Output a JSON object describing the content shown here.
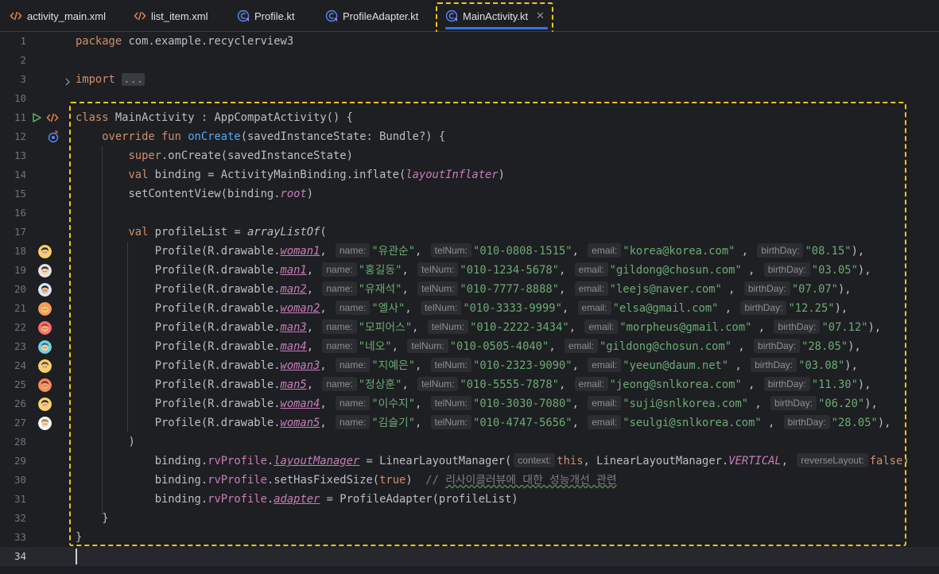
{
  "tabs": [
    {
      "label": "activity_main.xml",
      "icon": "xml-file-icon"
    },
    {
      "label": "list_item.xml",
      "icon": "xml-file-icon"
    },
    {
      "label": "Profile.kt",
      "icon": "kotlin-class-icon"
    },
    {
      "label": "ProfileAdapter.kt",
      "icon": "kotlin-class-icon"
    },
    {
      "label": "MainActivity.kt",
      "icon": "kotlin-class-icon",
      "active": true
    }
  ],
  "editor": {
    "line_numbers": [
      "1",
      "2",
      "3",
      "10",
      "11",
      "12",
      "13",
      "14",
      "15",
      "16",
      "17",
      "18",
      "19",
      "20",
      "21",
      "22",
      "23",
      "24",
      "25",
      "26",
      "27",
      "28",
      "29",
      "30",
      "31",
      "32",
      "33",
      "34"
    ],
    "package_kw": "package",
    "package_name": " com.example.recyclerview3",
    "import_kw": "import",
    "import_dots": "...",
    "class_kw": "class",
    "class_decl": " MainActivity : AppCompatActivity() {",
    "override_kw": "override",
    "fun_kw": " fun ",
    "fn_oncreate": "onCreate",
    "oncreate_params": "(savedInstanceState: Bundle?) {",
    "super_kw": "super",
    "super_call": ".onCreate(savedInstanceState)",
    "val_kw": "val",
    "binding_decl": " binding = ActivityMainBinding.inflate(",
    "layout_inflater": "layoutInflater",
    "close_paren": ")",
    "set_content_view": "setContentView(binding.",
    "root": "root",
    "profile_list_decl": " profileList = ",
    "array_list_of": "arrayListOf",
    "open_paren": "(",
    "profile_prefix": "Profile(R.drawable.",
    "hint_name": "name:",
    "hint_tel": "telNum:",
    "hint_email": "email:",
    "hint_birth": "birthDay:",
    "profiles": [
      {
        "drawable": "woman1",
        "name": "\"유관순\"",
        "tel": "\"010-0808-1515\"",
        "email": "\"korea@korea.com\"",
        "birth": "\"08.15\""
      },
      {
        "drawable": "man1",
        "name": "\"홍길동\"",
        "tel": "\"010-1234-5678\"",
        "email": "\"gildong@chosun.com\"",
        "birth": "\"03.05\""
      },
      {
        "drawable": "man2",
        "name": "\"유재석\"",
        "tel": "\"010-7777-8888\"",
        "email": "\"leejs@naver.com\"",
        "birth": "\"07.07\""
      },
      {
        "drawable": "woman2",
        "name": "\"엘사\"",
        "tel": "\"010-3333-9999\"",
        "email": "\"elsa@gmail.com\"",
        "birth": "\"12.25\""
      },
      {
        "drawable": "man3",
        "name": "\"모피어스\"",
        "tel": "\"010-2222-3434\"",
        "email": "\"morpheus@gmail.com\"",
        "birth": "\"07.12\""
      },
      {
        "drawable": "man4",
        "name": "\"네오\"",
        "tel": "\"010-0505-4040\"",
        "email": "\"gildong@chosun.com\"",
        "birth": "\"28.05\""
      },
      {
        "drawable": "woman3",
        "name": "\"지예은\"",
        "tel": "\"010-2323-9090\"",
        "email": "\"yeeun@daum.net\"",
        "birth": "\"03.08\""
      },
      {
        "drawable": "man5",
        "name": "\"정상훈\"",
        "tel": "\"010-5555-7878\"",
        "email": "\"jeong@snlkorea.com\"",
        "birth": "\"11.30\""
      },
      {
        "drawable": "woman4",
        "name": "\"이수지\"",
        "tel": "\"010-3030-7080\"",
        "email": "\"suji@snlkorea.com\"",
        "birth": "\"06.20\""
      },
      {
        "drawable": "woman5",
        "name": "\"김슬기\"",
        "tel": "\"010-4747-5656\"",
        "email": "\"seulgi@snlkorea.com\"",
        "birth": "\"28.05\""
      }
    ],
    "comma": ",",
    "comma_spaced": " ,",
    "row_end": "),",
    "binding_rv": "binding.",
    "rv_profile": "rvProfile",
    "dot": ".",
    "layout_manager": "layoutManager",
    "lm_assign": " = LinearLayoutManager(",
    "hint_context": "context:",
    "this_kw": "this",
    "lm_mid": ", LinearLayoutManager.",
    "vertical": "VERTICAL",
    "hint_reverse": "reverseLayout:",
    "false_kw": "false",
    "set_fixed_size": ".setHasFixedSize(",
    "true_kw": "true",
    "comment_prefix": "  // ",
    "comment_text": "리사이클러뷰에 대한 성능개선 관련",
    "adapter": "adapter",
    "adapter_assign": " = ProfileAdapter(profileList)",
    "close_brace": "}"
  },
  "colors": {
    "highlight": "#f5c518",
    "keyword": "#cf8e6d",
    "function": "#56a8f5",
    "string": "#6aab73",
    "property": "#c77dbb",
    "tab_underline": "#3574f0"
  }
}
